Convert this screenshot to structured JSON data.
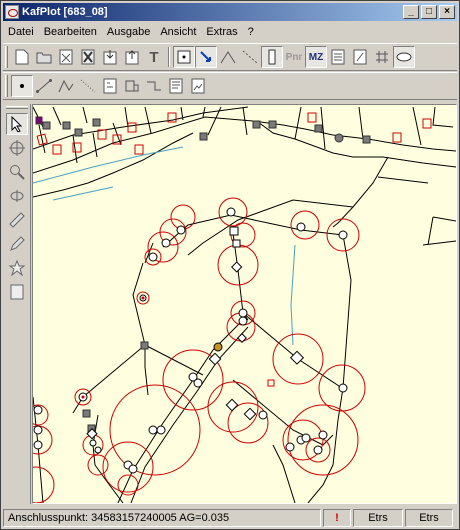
{
  "window": {
    "title": "KafPlot [683_08]"
  },
  "menu": [
    "Datei",
    "Bearbeiten",
    "Ausgabe",
    "Ansicht",
    "Extras",
    "?"
  ],
  "toolbar1": {
    "icons": [
      "new-file-icon",
      "open-folder-icon",
      "delete-page-icon",
      "cross-out-icon",
      "import-icon",
      "export-icon",
      "text-tool-icon",
      "point-select-icon",
      "arrow-select-icon",
      "angle-icon",
      "dashed-line-icon",
      "shape-select-icon"
    ],
    "pnr_label": "Pnr",
    "mz_label": "MZ",
    "tail_icons": [
      "list-icon",
      "edit-page-icon",
      "grid-icon",
      "ellipse-icon"
    ]
  },
  "toolbar2": {
    "icons": [
      "point-draw-icon",
      "line-draw-icon",
      "polyline-icon",
      "dotted-line-icon",
      "hatch-icon",
      "rect-step-icon",
      "step-line-icon",
      "text-doc-icon",
      "image-doc-icon"
    ]
  },
  "lefttoolbar": {
    "icons": [
      "pointer-icon",
      "crosshair-icon",
      "zoom-icon",
      "rotate-icon",
      "ruler-icon",
      "pencil-icon",
      "star-icon",
      "rectangle-icon"
    ]
  },
  "status": {
    "text": "Anschlusspunkt: 34583157240005   AG=0.035",
    "warning": "!",
    "crs1": "Etrs",
    "crs2": "Etrs"
  },
  "map_colors": {
    "background": "#ffffe0",
    "lines": "#000000",
    "circles": "#cc0000",
    "water": "#4aa0c0",
    "purple": "#800080"
  }
}
